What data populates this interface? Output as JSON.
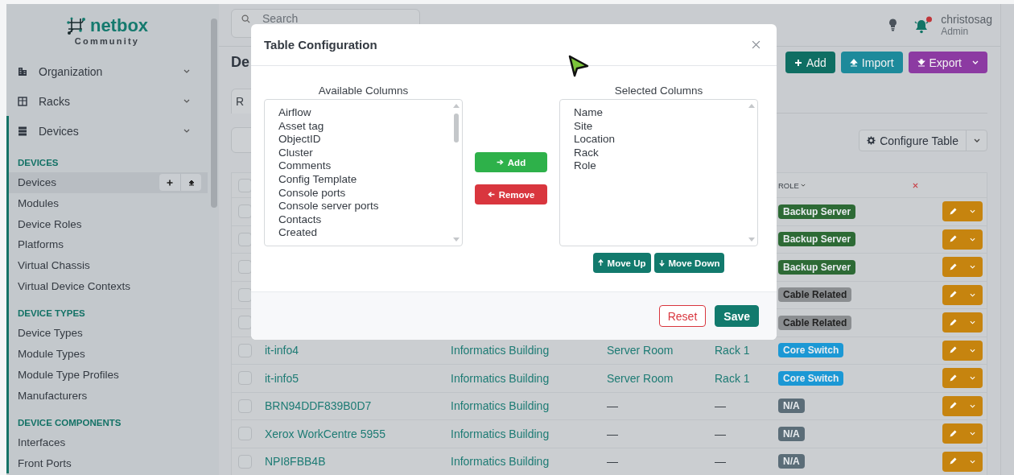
{
  "logo": {
    "name": "netbox",
    "edition": "Community"
  },
  "sidebar": {
    "menus": [
      {
        "label": "Organization",
        "expanded": false
      },
      {
        "label": "Racks",
        "expanded": false
      },
      {
        "label": "Devices",
        "expanded": true,
        "groups": [
          {
            "heading": "DEVICES",
            "items": [
              {
                "label": "Devices",
                "selected": true
              },
              {
                "label": "Modules",
                "selected": false
              },
              {
                "label": "Device Roles",
                "selected": false
              },
              {
                "label": "Platforms",
                "selected": false
              },
              {
                "label": "Virtual Chassis",
                "selected": false
              },
              {
                "label": "Virtual Device Contexts",
                "selected": false
              }
            ]
          },
          {
            "heading": "DEVICE TYPES",
            "items": [
              {
                "label": "Device Types",
                "selected": false
              },
              {
                "label": "Module Types",
                "selected": false
              },
              {
                "label": "Module Type Profiles",
                "selected": false
              },
              {
                "label": "Manufacturers",
                "selected": false
              }
            ]
          },
          {
            "heading": "DEVICE COMPONENTS",
            "items": [
              {
                "label": "Interfaces",
                "selected": false
              },
              {
                "label": "Front Ports",
                "selected": false
              }
            ]
          }
        ]
      }
    ]
  },
  "topbar": {
    "search": {
      "placeholder": "Search"
    },
    "notifications": {
      "unread": true
    },
    "user": {
      "name": "christosag",
      "role": "Admin"
    }
  },
  "page": {
    "heading": "De",
    "buttons": [
      {
        "label": "Add",
        "kind": "add"
      },
      {
        "label": "Import",
        "kind": "import"
      },
      {
        "label": "Export",
        "kind": "export"
      }
    ],
    "tabs": [
      {
        "label": "R",
        "selected": true
      }
    ],
    "configure_button": {
      "label": "Configure Table"
    }
  },
  "table": {
    "all_selected": false,
    "role_header": "ROLE",
    "rows": [
      {
        "selected": false,
        "role": {
          "label": "Backup Server",
          "color": "#2d6a35"
        }
      },
      {
        "selected": false,
        "role": {
          "label": "Backup Server",
          "color": "#2d6a35"
        }
      },
      {
        "selected": false,
        "role": {
          "label": "Backup Server",
          "color": "#2d6a35"
        }
      },
      {
        "selected": false,
        "role": {
          "label": "Cable Related",
          "color": "#8b8e91"
        }
      },
      {
        "selected": false,
        "role": {
          "label": "Cable Related",
          "color": "#8b8e91"
        }
      },
      {
        "selected": false,
        "name": "it-info4",
        "site": "Informatics Building",
        "location": "Server Room",
        "rack": "Rack 1",
        "role": {
          "label": "Core Switch",
          "color": "#1b98d5"
        }
      },
      {
        "selected": false,
        "name": "it-info5",
        "site": "Informatics Building",
        "location": "Server Room",
        "rack": "Rack 1",
        "role": {
          "label": "Core Switch",
          "color": "#1b98d5"
        }
      },
      {
        "selected": false,
        "name": "BRN94DDF839B0D7",
        "site": "Informatics Building",
        "location": "—",
        "rack": "—",
        "role": {
          "label": "N/A",
          "color": "#5b6d78"
        }
      },
      {
        "selected": false,
        "name": "Xerox WorkCentre 5955",
        "site": "Informatics Building",
        "location": "—",
        "rack": "—",
        "role": {
          "label": "N/A",
          "color": "#5b6d78"
        }
      },
      {
        "selected": false,
        "name": "NPI8FBB4B",
        "site": "Informatics Building",
        "location": "—",
        "rack": "—",
        "role": {
          "label": "N/A",
          "color": "#5b6d78"
        }
      }
    ]
  },
  "modal": {
    "title": "Table Configuration",
    "available": {
      "label": "Available Columns",
      "items": [
        "Airflow",
        "Asset tag",
        "ObjectID",
        "Cluster",
        "Comments",
        "Config Template",
        "Console ports",
        "Console server ports",
        "Contacts",
        "Created"
      ]
    },
    "selected": {
      "label": "Selected Columns",
      "items": [
        "Name",
        "Site",
        "Location",
        "Rack",
        "Role"
      ]
    },
    "transfer_buttons": [
      {
        "label": "Add",
        "kind": "add"
      },
      {
        "label": "Remove",
        "kind": "remove"
      }
    ],
    "order_buttons": [
      {
        "label": "Move Up",
        "kind": "up"
      },
      {
        "label": "Move Down",
        "kind": "down"
      }
    ],
    "footer_buttons": [
      {
        "label": "Reset",
        "kind": "reset"
      },
      {
        "label": "Save",
        "kind": "save"
      }
    ]
  }
}
